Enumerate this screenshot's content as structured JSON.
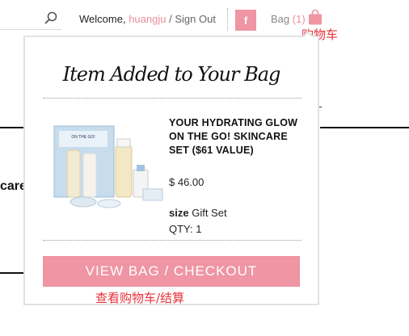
{
  "header": {
    "welcome_prefix": "Welcome,",
    "username": "huangju",
    "separator": "/",
    "sign_out": "Sign Out",
    "facebook_label": "f",
    "bag_label": "Bag",
    "bag_count": "(1)",
    "search_icon": "search-icon",
    "bag_icon": "shopping-bag-icon"
  },
  "annotations": {
    "cart": "购物车",
    "checkout": "查看购物车/结算"
  },
  "background": {
    "partial_text": "care"
  },
  "popup": {
    "title": "Item Added to Your Bag",
    "product": {
      "name": "YOUR HYDRATING GLOW ON THE GO! SKINCARE SET ($61 VALUE)",
      "price": "$ 46.00",
      "size_label": "size",
      "size_value": "Gift Set",
      "qty_label": "QTY:",
      "qty_value": "1"
    },
    "checkout_button": "VIEW BAG / CHECKOUT"
  },
  "colors": {
    "accent_pink": "#ef95a3",
    "annotation_red": "#e8313a"
  }
}
